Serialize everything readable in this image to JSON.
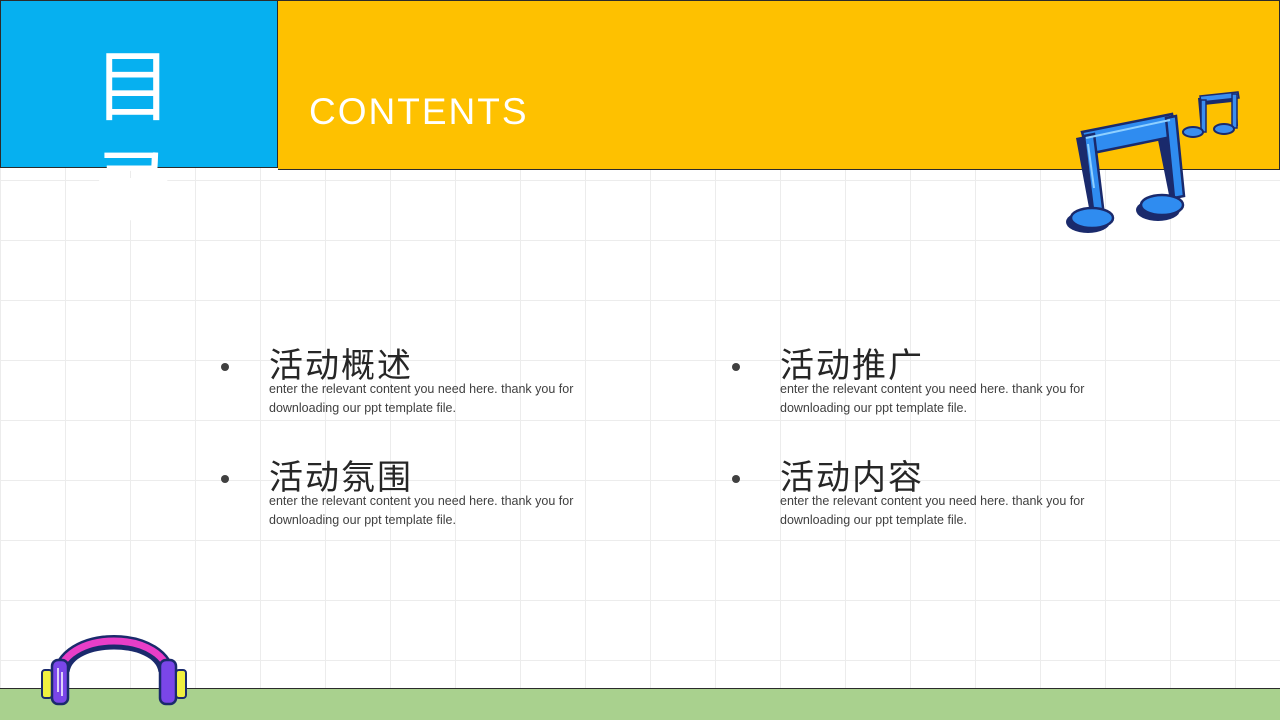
{
  "header": {
    "title_cn": "目 录",
    "title_en": "CONTENTS"
  },
  "items": [
    {
      "title": "活动概述",
      "desc": "enter the relevant content you need here. thank you for downloading our ppt template file."
    },
    {
      "title": "活动推广",
      "desc": "enter the relevant content you need here. thank you for downloading our ppt template file."
    },
    {
      "title": "活动氛围",
      "desc": "enter the relevant content you need here. thank you for downloading our ppt template file."
    },
    {
      "title": "活动内容",
      "desc": "enter the relevant content you need here. thank you for downloading our ppt template file."
    }
  ],
  "decorations": {
    "top_right": "music-note-icon",
    "bottom_left": "headphones-icon"
  },
  "colors": {
    "header_blue": "#06b0f0",
    "header_yellow": "#fec100",
    "footer_green": "#a9d18e",
    "note_blue": "#2f8cf0",
    "headphone_pink": "#e83ec8",
    "headphone_purple": "#7a46e8"
  }
}
